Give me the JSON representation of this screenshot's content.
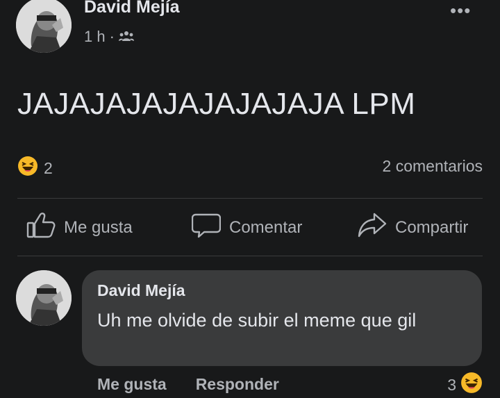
{
  "post": {
    "author": "David Mejía",
    "time": "1 h",
    "separator": "·",
    "privacy_icon": "friends-icon",
    "more_label": "•••",
    "text": "JAJAJAJAJAJAJAJAJA LPM",
    "reaction_icon": "haha-icon",
    "reaction_count": "2",
    "comments_count": "2 comentarios"
  },
  "actions": {
    "like": "Me gusta",
    "comment": "Comentar",
    "share": "Compartir"
  },
  "comment": {
    "author": "David Mejía",
    "text": "Uh me olvide de subir el meme que gil",
    "like_label": "Me gusta",
    "reply_label": "Responder",
    "reaction_count": "3",
    "reaction_icon": "haha-icon"
  },
  "colors": {
    "background": "#18191a",
    "bubble": "#3a3b3c",
    "primary_text": "#e4e6eb",
    "secondary_text": "#b0b3b8",
    "haha_emoji": "#f7b928"
  }
}
